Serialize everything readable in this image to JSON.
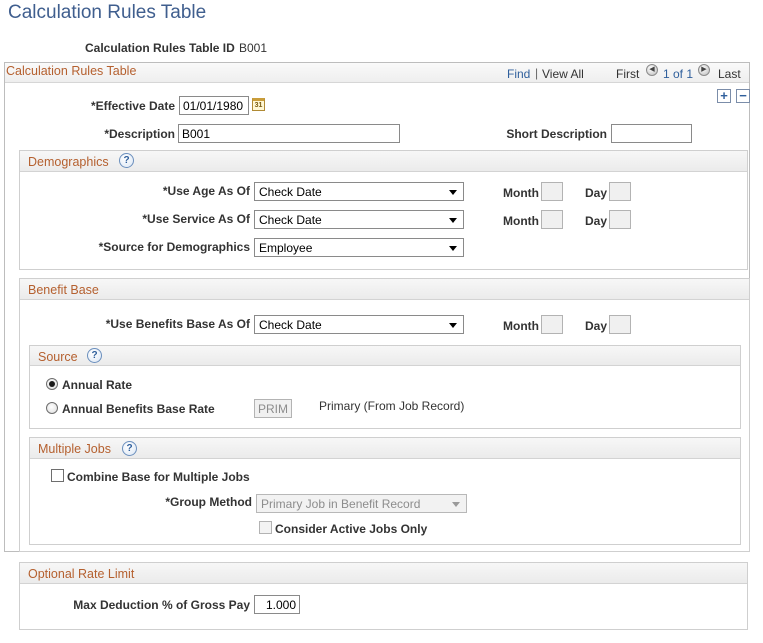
{
  "page": {
    "title": "Calculation Rules Table",
    "id_label": "Calculation Rules Table ID",
    "id_value": "B001"
  },
  "grid": {
    "title": "Calculation Rules Table",
    "find": "Find",
    "separator": "|",
    "view_all": "View All",
    "first": "First",
    "counter": "1 of 1",
    "last": "Last"
  },
  "record": {
    "effective_date_label": "*Effective Date",
    "effective_date_value": "01/01/1980",
    "calendar_icon_text": "31",
    "description_label": "*Description",
    "description_value": "B001",
    "short_description_label": "Short Description",
    "short_description_value": ""
  },
  "demographics": {
    "title": "Demographics",
    "rows": [
      {
        "label": "*Use Age As Of",
        "value": "Check Date",
        "month_label": "Month",
        "day_label": "Day"
      },
      {
        "label": "*Use Service As Of",
        "value": "Check Date",
        "month_label": "Month",
        "day_label": "Day"
      },
      {
        "label": "*Source for Demographics",
        "value": "Employee"
      }
    ]
  },
  "benefit_base": {
    "title": "Benefit Base",
    "use_label": "*Use Benefits Base As Of",
    "use_value": "Check Date",
    "month_label": "Month",
    "day_label": "Day",
    "source": {
      "title": "Source",
      "annual_rate_label": "Annual Rate",
      "annual_benefits_base_rate_label": "Annual Benefits Base Rate",
      "rate_code_value": "PRIM",
      "rate_code_description": "Primary (From Job Record)"
    },
    "multiple_jobs": {
      "title": "Multiple Jobs",
      "combine_label": "Combine Base for Multiple Jobs",
      "group_method_label": "*Group Method",
      "group_method_value": "Primary Job in Benefit Record",
      "active_only_label": "Consider Active Jobs Only"
    }
  },
  "optional_rate_limit": {
    "title": "Optional Rate Limit",
    "max_deduction_label": "Max Deduction % of Gross Pay",
    "max_deduction_value": "1.000"
  },
  "icons": {
    "help": "?",
    "add": "+",
    "delete": "−",
    "prev": "◀",
    "next": "▶"
  }
}
